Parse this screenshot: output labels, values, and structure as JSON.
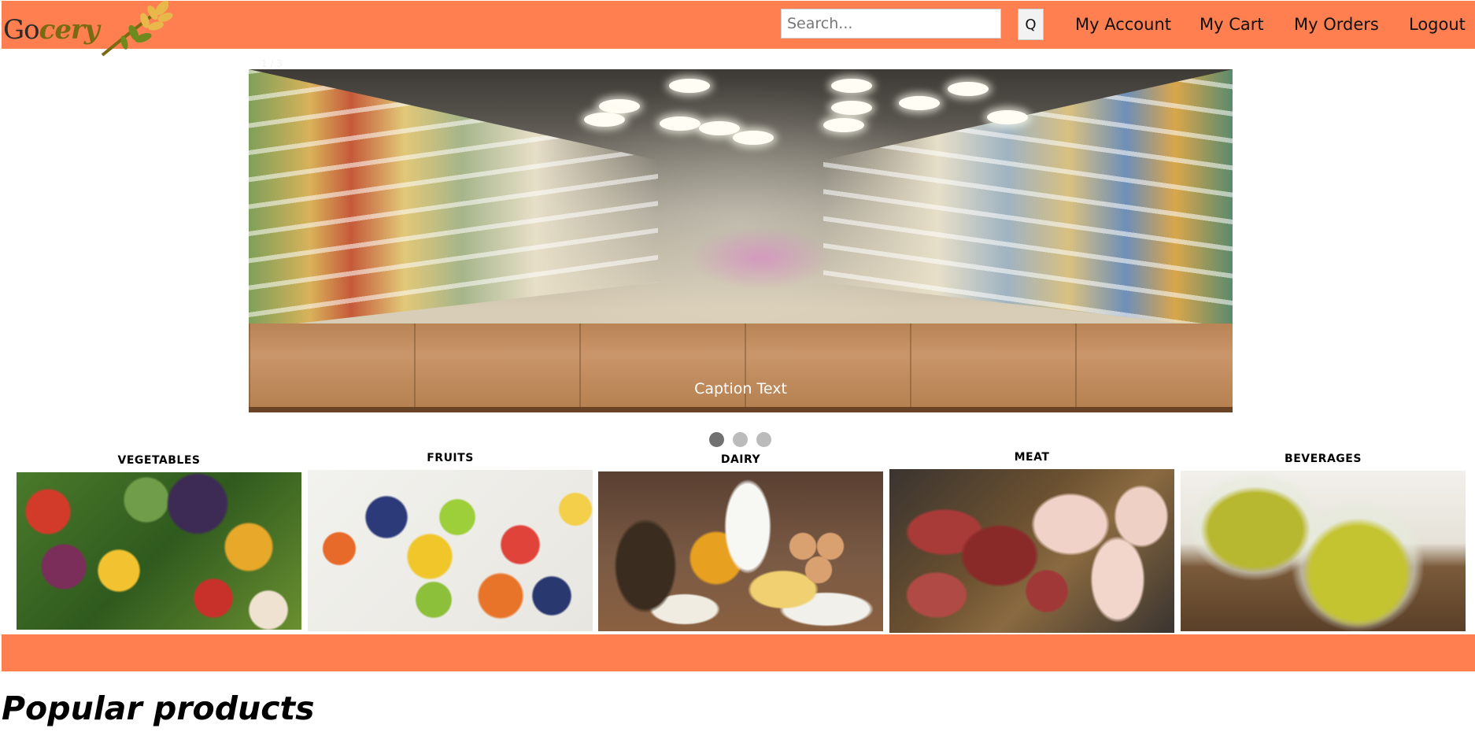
{
  "header": {
    "logo_text_a": "Go",
    "logo_text_b": "cery",
    "search_placeholder": "Search...",
    "search_button_label": "Q",
    "nav": [
      {
        "label": "My Account"
      },
      {
        "label": "My Cart"
      },
      {
        "label": "My Orders"
      },
      {
        "label": "Logout"
      }
    ],
    "brand_color": "#ff7f50"
  },
  "slideshow": {
    "counter": "1 / 3",
    "caption": "Caption Text",
    "dots": [
      {
        "active": true
      },
      {
        "active": false
      },
      {
        "active": false
      }
    ]
  },
  "categories": [
    {
      "title": "VEGETABLES"
    },
    {
      "title": "FRUITS"
    },
    {
      "title": "DAIRY"
    },
    {
      "title": "MEAT"
    },
    {
      "title": "BEVERAGES"
    }
  ],
  "section": {
    "title": "Popular products"
  }
}
